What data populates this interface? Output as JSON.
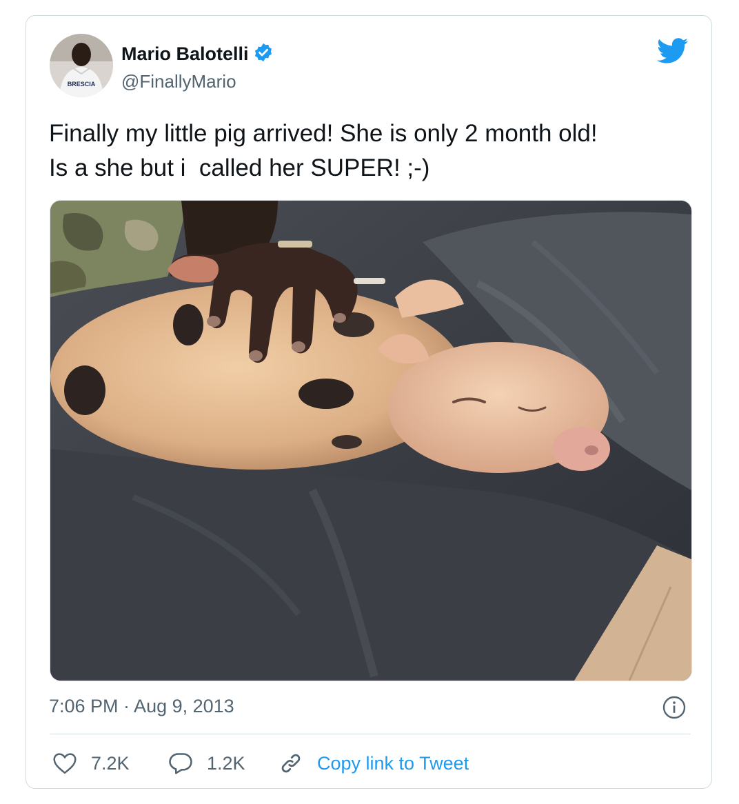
{
  "author": {
    "display_name": "Mario Balotelli",
    "handle": "@FinallyMario",
    "verified": true,
    "avatar_jersey_text": "BRESCIA"
  },
  "tweet": {
    "text": "Finally my little pig arrived! She is only 2 month old!\nIs a she but i  called her SUPER! ;-)",
    "timestamp": "7:06 PM · Aug 9, 2013"
  },
  "actions": {
    "likes_count": "7.2K",
    "replies_count": "1.2K",
    "copy_link_label": "Copy link to Tweet"
  },
  "colors": {
    "brand_blue": "#1d9bf0",
    "text_primary": "#0f1419",
    "text_secondary": "#536471",
    "border": "#cfd9de"
  },
  "icons": [
    "verified-badge-icon",
    "twitter-bird-icon",
    "info-icon",
    "heart-icon",
    "reply-bubble-icon",
    "link-icon"
  ]
}
